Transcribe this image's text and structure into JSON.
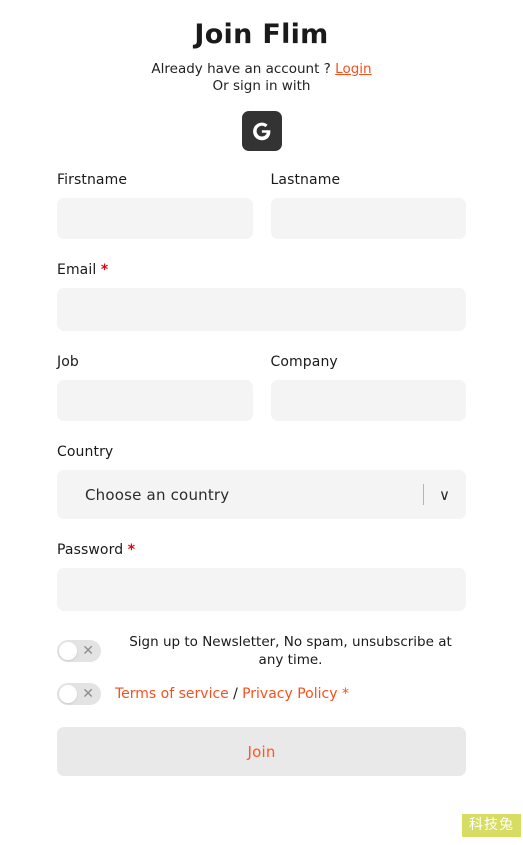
{
  "header": {
    "title": "Join Flim",
    "account_prompt": "Already have an account ?",
    "login_label": "Login",
    "or_sign_in_with": "Or sign in with",
    "google_glyph": "G",
    "google_icon_name": "google-icon"
  },
  "form": {
    "firstname": {
      "label": "Firstname",
      "value": "",
      "placeholder": ""
    },
    "lastname": {
      "label": "Lastname",
      "value": "",
      "placeholder": ""
    },
    "email": {
      "label": "Email",
      "required_mark": "*",
      "value": "",
      "placeholder": ""
    },
    "job": {
      "label": "Job",
      "value": "",
      "placeholder": ""
    },
    "company": {
      "label": "Company",
      "value": "",
      "placeholder": ""
    },
    "country": {
      "label": "Country",
      "selected": "Choose an country",
      "chevron": "∨",
      "options": [
        "Choose an country"
      ]
    },
    "password": {
      "label": "Password",
      "required_mark": "*",
      "value": "",
      "placeholder": ""
    }
  },
  "toggles": {
    "newsletter": {
      "text": "Sign up to Newsletter, No spam, unsubscribe at any time.",
      "state_glyph": "✕",
      "checked": false
    },
    "terms": {
      "terms_label": "Terms of service",
      "separator": "/",
      "privacy_label": "Privacy Policy *",
      "state_glyph": "✕",
      "checked": false
    }
  },
  "submit": {
    "label": "Join"
  },
  "watermark": {
    "text": "科技兔"
  },
  "colors": {
    "accent": "#f4511e",
    "submit_text": "#ff5722",
    "required": "#e8000d",
    "field_bg": "#f4f4f4",
    "button_bg": "#e9e9e9",
    "google_bg": "#333333",
    "watermark_bg": "#d7dd63"
  }
}
